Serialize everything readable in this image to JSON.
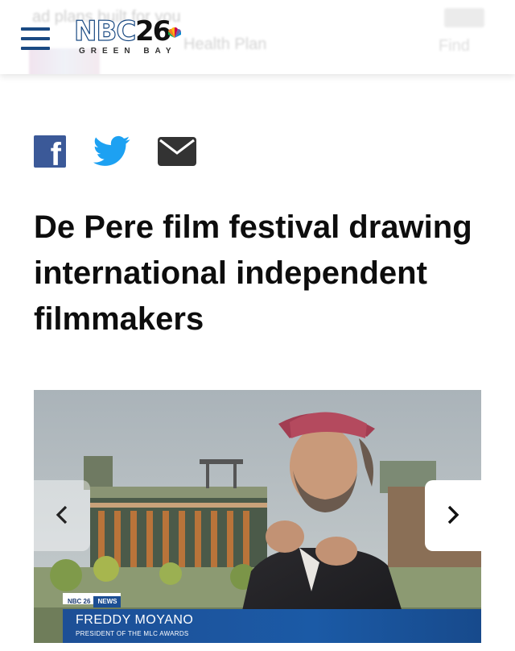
{
  "header": {
    "logo_text": "NBC",
    "logo_number": "26",
    "logo_city": "GREEN BAY",
    "background_ad": {
      "line1": "ad plans built for you",
      "line2": "Health Plan",
      "right_text": "Find"
    }
  },
  "share": {
    "facebook_glyph": "f"
  },
  "article": {
    "headline": "De Pere film festival drawing international independent filmmakers"
  },
  "media": {
    "lower_third": {
      "station_tag": "NBC 26",
      "section_tag": "NEWS",
      "name": "FREDDY MOYANO",
      "title": "PRESIDENT OF THE MLC AWARDS"
    }
  },
  "colors": {
    "brand_blue": "#1a4a83",
    "facebook": "#3b5998",
    "twitter": "#1da1f2",
    "mail": "#333333",
    "lower_third": "#1d4f96"
  }
}
